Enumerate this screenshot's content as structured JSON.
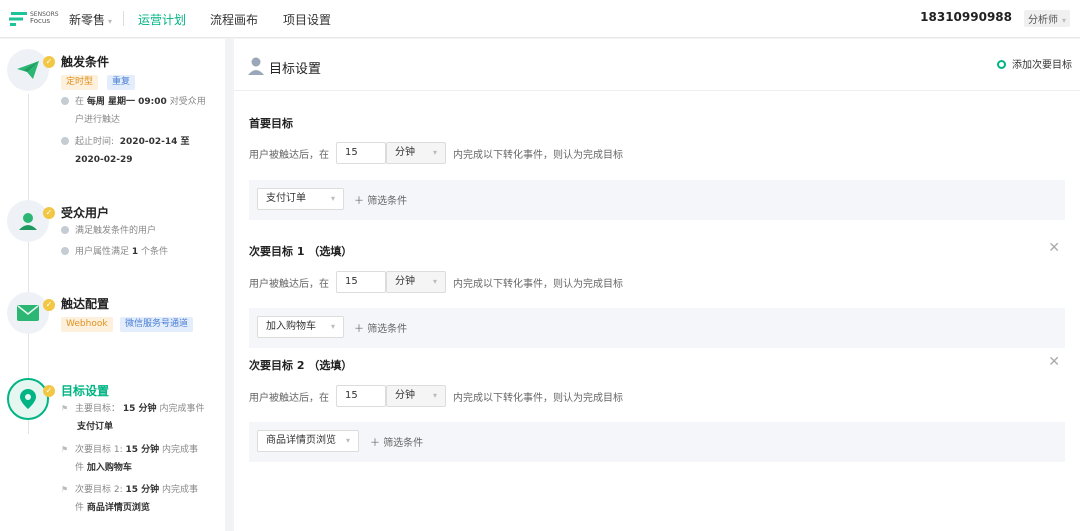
{
  "topbar": {
    "logo_line1": "SENSORS",
    "logo_line2": "Focus",
    "project": "新零售",
    "nav": [
      "运营计划",
      "流程画布",
      "项目设置"
    ],
    "active_nav": "运营计划",
    "phone": "18310990988",
    "role": "分析师"
  },
  "steps": {
    "trigger": {
      "title": "触发条件",
      "tags": [
        "定时型",
        "重复"
      ],
      "schedule_prefix": "在",
      "schedule_bold": "每周 星期一 09:00",
      "schedule_suffix": "对受众用",
      "schedule_line2": "户进行触达",
      "period_label": "起止时间:",
      "period_start": "2020-02-14 至",
      "period_end": "2020-02-29"
    },
    "audience": {
      "title": "受众用户",
      "line1": "满足触发条件的用户",
      "line2_prefix": "用户属性满足",
      "line2_count": "1",
      "line2_suffix": "个条件"
    },
    "reach": {
      "title": "触达配置",
      "tags": [
        "Webhook",
        "微信服务号通道"
      ]
    },
    "goal": {
      "title": "目标设置",
      "primary_label": "主要目标：",
      "primary_time": "15 分钟",
      "primary_suffix": "内完成事件",
      "primary_event": "支付订单",
      "sec1_label": "次要目标 1:",
      "sec1_time": "15 分钟",
      "sec1_suffix": "内完成事",
      "sec1_cont": "件",
      "sec1_event": "加入购物车",
      "sec2_label": "次要目标 2:",
      "sec2_time": "15 分钟",
      "sec2_suffix": "内完成事",
      "sec2_cont": "件",
      "sec2_event": "商品详情页浏览"
    }
  },
  "main": {
    "title": "目标设置",
    "add_goal": "添加次要目标",
    "goals": [
      {
        "title": "首要目标",
        "prefix": "用户被触达后，在",
        "value": "15",
        "unit": "分钟",
        "suffix": "内完成以下转化事件，则认为完成目标",
        "event": "支付订单",
        "filter": "筛选条件"
      },
      {
        "title": "次要目标 1 （选填）",
        "prefix": "用户被触达后，在",
        "value": "15",
        "unit": "分钟",
        "suffix": "内完成以下转化事件，则认为完成目标",
        "event": "加入购物车",
        "filter": "筛选条件"
      },
      {
        "title": "次要目标 2 （选填）",
        "prefix": "用户被触达后，在",
        "value": "15",
        "unit": "分钟",
        "suffix": "内完成以下转化事件，则认为完成目标",
        "event": "商品详情页浏览",
        "filter": "筛选条件"
      }
    ]
  },
  "colors": {
    "accent": "#00b483",
    "check": "#f2c744",
    "tag_orange": "#e0901f",
    "tag_blue": "#4a7fd4"
  },
  "icons": [
    "paper-plane-icon",
    "user-icon",
    "mail-icon",
    "location-pin-icon",
    "check-icon",
    "close-icon",
    "plus-icon",
    "flag-icon",
    "clock-icon"
  ]
}
